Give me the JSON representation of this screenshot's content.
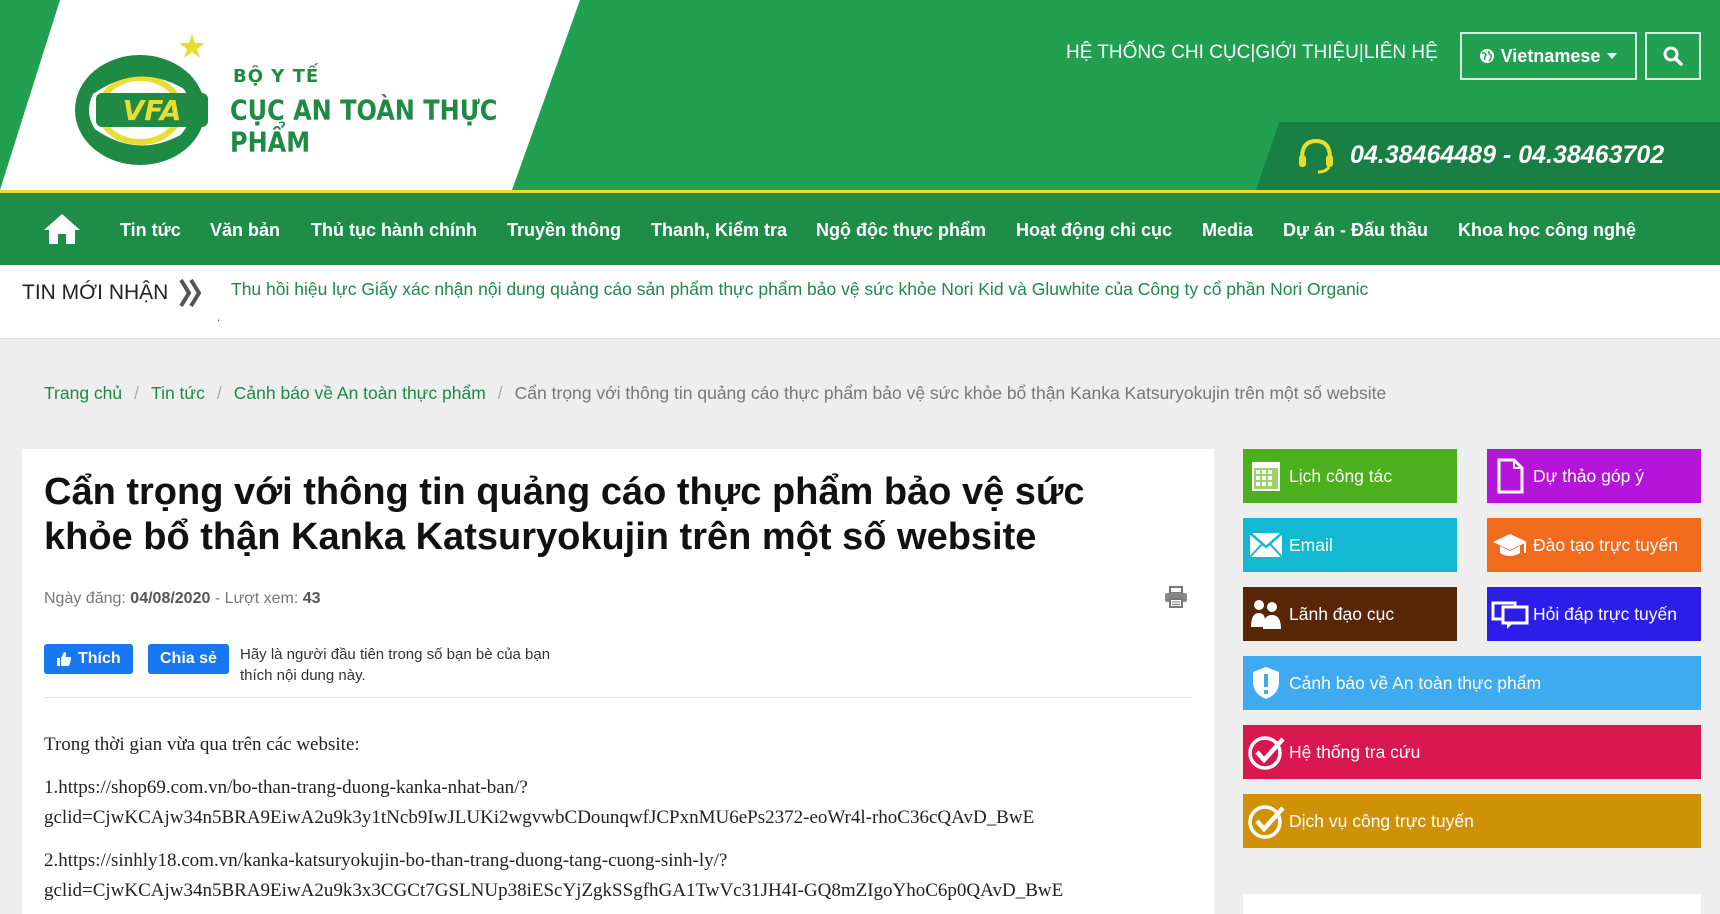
{
  "header": {
    "org_line1": "BỘ Y TẾ",
    "org_line2": "CỤC AN TOÀN THỰC PHẨM",
    "logo_text": "VFA",
    "top_links": [
      "HỆ THỐNG CHI CỤC",
      "GIỚI THIỆU",
      "LIÊN HỆ"
    ],
    "link_separator": " | ",
    "language": "Vietnamese",
    "phone": "04.38464489 - 04.38463702"
  },
  "nav": {
    "items": [
      "Tin tức",
      "Văn bản",
      "Thủ tục hành chính",
      "Truyền thông",
      "Thanh, Kiểm tra",
      "Ngộ độc thực phẩm",
      "Hoạt động chi cục",
      "Media",
      "Dự án - Đấu thầu",
      "Khoa học công nghệ"
    ]
  },
  "ticker": {
    "label": "TIN MỚI NHẬN",
    "text": "Thu hồi hiệu lực Giấy xác nhận nội dung quảng cáo sản phẩm thực phẩm bảo vệ sức khỏe Nori Kid và Gluwhite của Công ty cổ phần Nori Organic",
    "dot": "."
  },
  "breadcrumb": {
    "items": [
      "Trang chủ",
      "Tin tức",
      "Cảnh báo về An toàn thực phẩm"
    ],
    "separator": "/",
    "current": "Cẩn trọng với thông tin quảng cáo thực phẩm bảo vệ sức khỏe bổ thận Kanka Katsuryokujin trên một số website"
  },
  "article": {
    "title_line1": "Cẩn trọng với thông tin quảng cáo thực phẩm bảo vệ sức",
    "title_line2": "khỏe bổ thận Kanka Katsuryokujin trên một số website",
    "date_label": "Ngày đăng:",
    "date": "04/08/2020",
    "views_label": " - Lượt xem:",
    "views": "43",
    "like_label": "Thích",
    "share_label": "Chia sẻ",
    "social_text_line1": "Hãy là người đầu tiên trong số bạn bè của bạn",
    "social_text_line2": "thích nội dung này.",
    "paragraphs": [
      "Trong thời gian vừa qua trên các website:",
      "1.https://shop69.com.vn/bo-than-trang-duong-kanka-nhat-ban/?",
      "gclid=CjwKCAjw34n5BRA9EiwA2u9k3y1tNcb9IwJLUKi2wgvwbCDounqwfJCPxnMU6ePs2372-eoWr4l-rhoC36cQAvD_BwE",
      "2.https://sinhly18.com.vn/kanka-katsuryokujin-bo-than-trang-duong-tang-cuong-sinh-ly/?",
      "gclid=CjwKCAjw34n5BRA9EiwA2u9k3x3CGCt7GSLNUp38iEScYjZgkSSgfhGA1TwVc31JH4I-GQ8mZIgoYhoC6p0QAvD_BwE"
    ]
  },
  "sidebar": {
    "buttons": [
      {
        "label": "Lịch công tác",
        "color": "#4caf1d",
        "icon": "calendar-icon"
      },
      {
        "label": "Dự thảo góp ý",
        "color": "#b514d9",
        "icon": "document-icon"
      },
      {
        "label": "Email",
        "color": "#13b8d2",
        "icon": "envelope-icon"
      },
      {
        "label": "Đào tạo trực tuyến",
        "color": "#f26b1d",
        "icon": "graduation-cap-icon"
      },
      {
        "label": "Lãnh đạo cục",
        "color": "#5a2608",
        "icon": "people-icon"
      },
      {
        "label": "Hỏi đáp trực tuyến",
        "color": "#2d1de8",
        "icon": "chat-icon"
      },
      {
        "label": "Cảnh báo về An toàn thực phẩm",
        "color": "#3eaaf0",
        "icon": "shield-alert-icon"
      },
      {
        "label": "Hệ thống tra cứu",
        "color": "#d9174f",
        "icon": "check-circle-icon"
      },
      {
        "label": "Dịch vụ công trực tuyến",
        "color": "#cf9207",
        "icon": "check-circle-icon"
      }
    ]
  },
  "colors": {
    "brand_green": "#21a052",
    "nav_green": "#1d8d48",
    "accent_yellow": "#eedc2a",
    "link_green": "#1e8a44"
  }
}
